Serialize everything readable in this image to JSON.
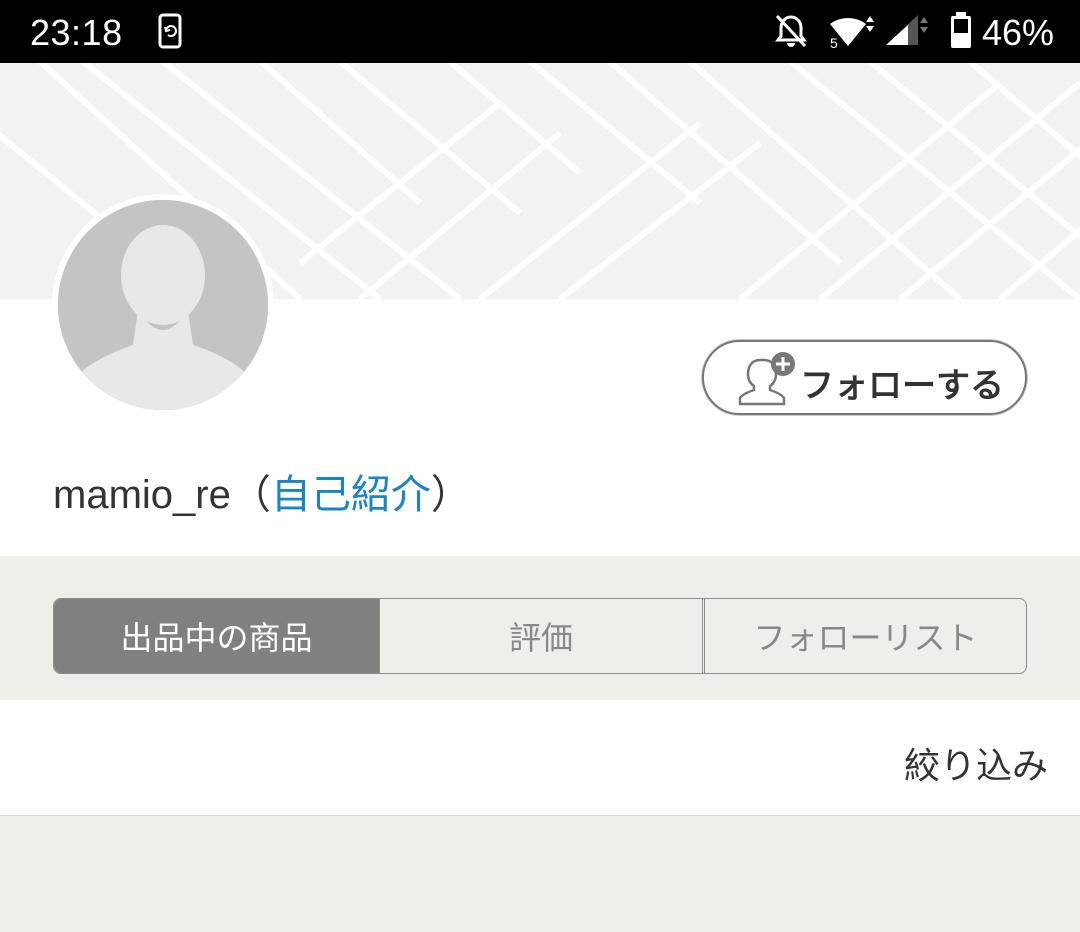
{
  "status_bar": {
    "time": "23:18",
    "battery": "46%",
    "icons": [
      "sync-icon",
      "bell-off-icon",
      "wifi-icon",
      "signal-icon",
      "battery-icon"
    ]
  },
  "profile": {
    "username": "mamio_re",
    "paren_open": "（",
    "intro_link": "自己紹介",
    "paren_close": "）",
    "follow_button": "フォローする"
  },
  "tabs": [
    {
      "label": "出品中の商品",
      "active": true
    },
    {
      "label": "評価",
      "active": false
    },
    {
      "label": "フォローリスト",
      "active": false
    }
  ],
  "filter": {
    "label": "絞り込み"
  },
  "colors": {
    "link": "#1a84c6",
    "active_tab": "#808080",
    "background": "#efeee8"
  }
}
